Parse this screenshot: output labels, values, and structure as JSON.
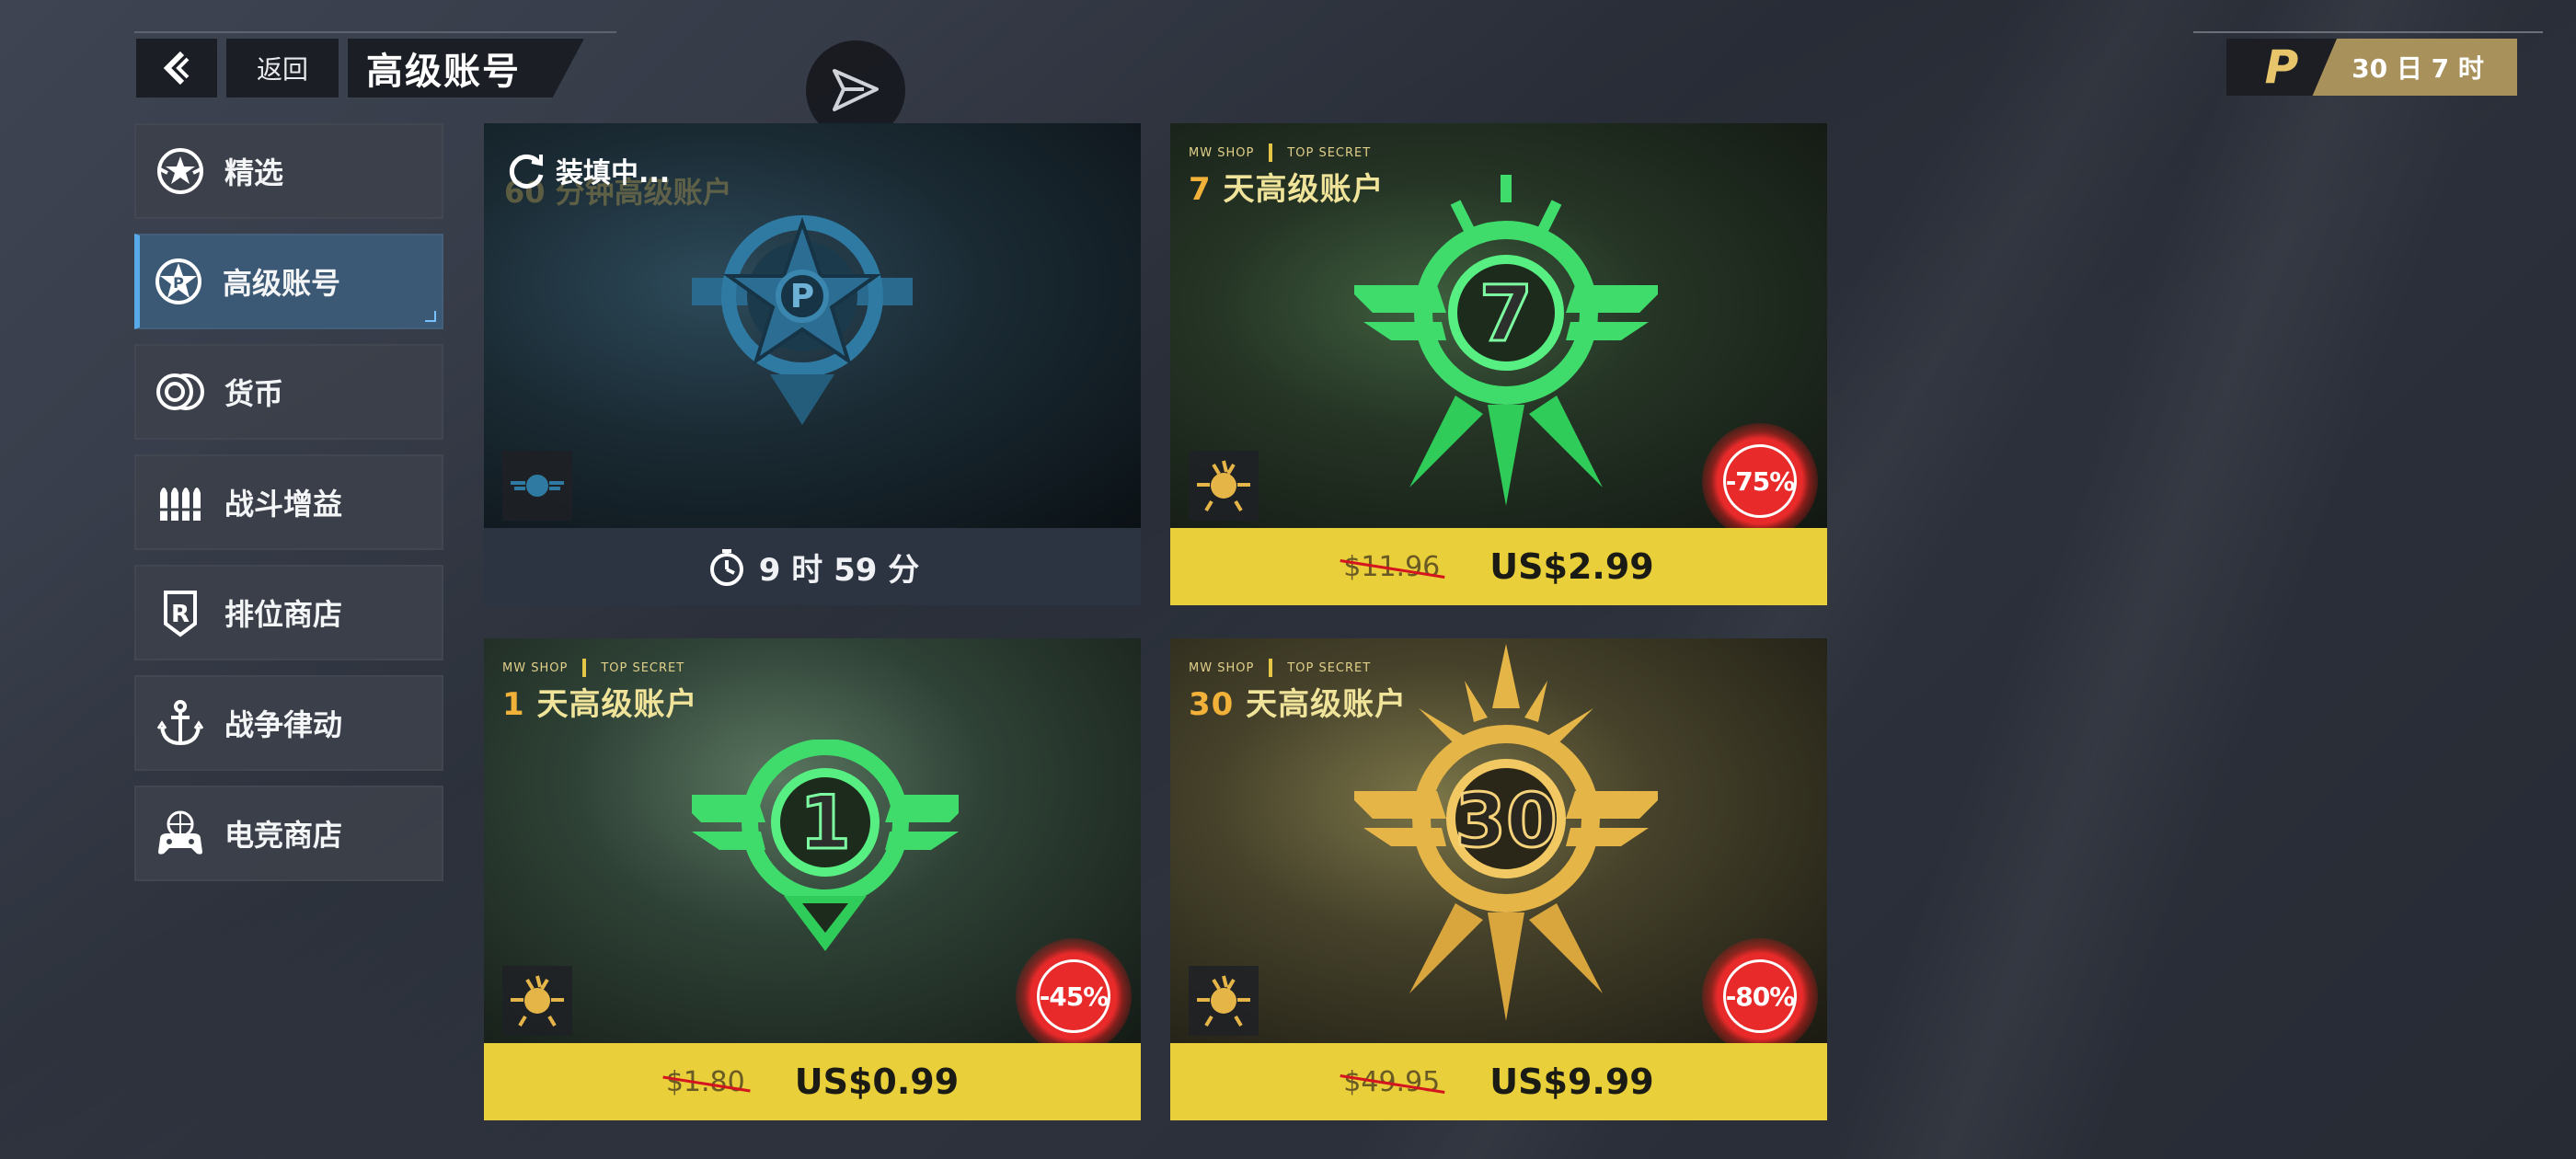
{
  "header": {
    "back_icon": "chevron-left-icon",
    "return_label": "返回",
    "title": "高级账号"
  },
  "premium_badge": {
    "logo_letter": "P",
    "remaining": "30 日 7 时"
  },
  "sidebar": {
    "items": [
      {
        "label": "精选",
        "icon": "star-badge-icon",
        "active": false
      },
      {
        "label": "高级账号",
        "icon": "star-p-icon",
        "active": true
      },
      {
        "label": "货币",
        "icon": "coins-icon",
        "active": false
      },
      {
        "label": "战斗增益",
        "icon": "ammo-icon",
        "active": false
      },
      {
        "label": "排位商店",
        "icon": "ranked-shield-icon",
        "active": false
      },
      {
        "label": "战争律动",
        "icon": "anchor-icon",
        "active": false
      },
      {
        "label": "电竞商店",
        "icon": "gamepad-globe-icon",
        "active": false
      }
    ]
  },
  "cards": {
    "free": {
      "loading_label": "装填中...",
      "ghost_title": "60 分钟高级账户",
      "emblem_letter": "P",
      "timer": "9 时 59 分"
    },
    "seven_day": {
      "tag_left": "MW SHOP",
      "tag_right": "TOP SECRET",
      "title_num": "7",
      "title_rest": " 天高级账户",
      "emblem_number": "7",
      "discount": "-75%",
      "old_price": "$11.96",
      "new_price": "US$2.99"
    },
    "one_day": {
      "tag_left": "MW SHOP",
      "tag_right": "TOP SECRET",
      "title_num": "1",
      "title_rest": " 天高级账户",
      "emblem_number": "1",
      "discount": "-45%",
      "old_price": "$1.80",
      "new_price": "US$0.99"
    },
    "thirty_day": {
      "tag_left": "MW SHOP",
      "tag_right": "TOP SECRET",
      "title_num": "30",
      "title_rest": " 天高级账户",
      "emblem_number": "30",
      "discount": "-80%",
      "old_price": "$49.95",
      "new_price": "US$9.99"
    }
  },
  "colors": {
    "accent_blue": "#58a9e8",
    "price_bar_yellow": "#e9cf3a",
    "discount_red": "#e82a2a",
    "emblem_green": "#3fdc6c",
    "emblem_gold": "#e6b548",
    "emblem_blue": "#2c6d93"
  }
}
